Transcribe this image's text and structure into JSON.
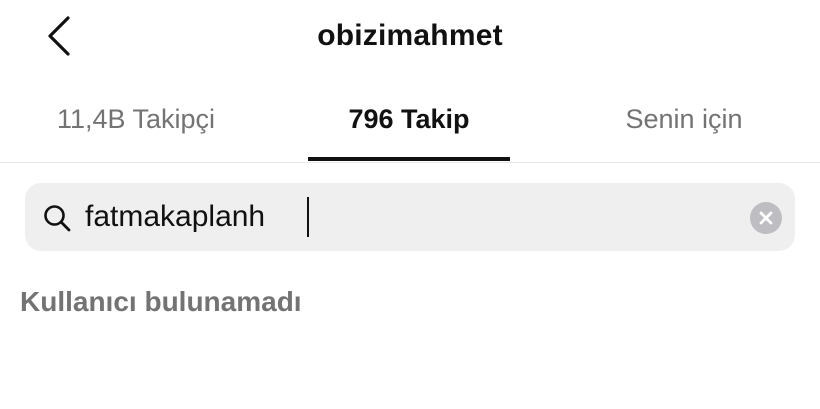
{
  "header": {
    "back_icon": "chevron-left-icon",
    "title": "obizimahmet"
  },
  "tabs": [
    {
      "label": "11,4B Takipçi",
      "active": false
    },
    {
      "label": "796 Takip",
      "active": true
    },
    {
      "label": "Senin için",
      "active": false
    }
  ],
  "search": {
    "icon": "search-icon",
    "value": "fatmakaplanh",
    "clear_icon": "clear-icon"
  },
  "results": {
    "empty_message": "Kullanıcı bulunamadı"
  },
  "colors": {
    "text_primary": "#111111",
    "text_secondary": "#737373",
    "search_bg": "#efeff0",
    "clear_bg": "#bdbdc2"
  }
}
